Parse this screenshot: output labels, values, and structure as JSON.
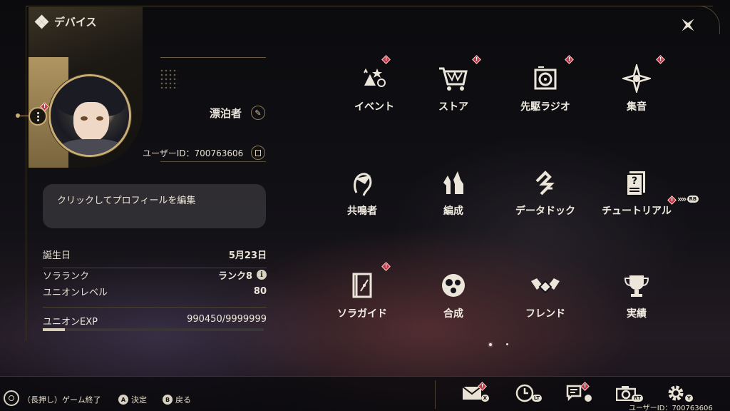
{
  "header": {
    "title": "デバイス"
  },
  "profile": {
    "nickname": "漂泊者",
    "user_id_label": "ユーザーID：700763606",
    "edit_profile_text": "クリックしてプロフィールを編集",
    "stats": [
      {
        "label": "誕生日",
        "value": "5月23日"
      },
      {
        "label": "ソラランク",
        "value": "ランク8"
      },
      {
        "label": "ユニオンレベル",
        "value": "80"
      }
    ],
    "exp": {
      "label": "ユニオンEXP",
      "value": "990450/9999999",
      "fraction": 0.099
    },
    "info_glyph": "i"
  },
  "grid": {
    "items": [
      {
        "label": "イベント",
        "icon": "event-icon",
        "badge": true
      },
      {
        "label": "ストア",
        "icon": "store-cart-icon",
        "badge": true
      },
      {
        "label": "先駆ラジオ",
        "icon": "radio-icon",
        "badge": true
      },
      {
        "label": "集音",
        "icon": "compass-star-icon",
        "badge": true
      },
      {
        "label": "共鳴者",
        "icon": "resonator-head-icon",
        "badge": false
      },
      {
        "label": "編成",
        "icon": "team-chess-icon",
        "badge": false
      },
      {
        "label": "データドック",
        "icon": "data-dock-icon",
        "badge": false
      },
      {
        "label": "チュートリアル",
        "icon": "tutorial-icon",
        "badge": false
      },
      {
        "label": "ソラガイド",
        "icon": "guide-book-icon",
        "badge": true
      },
      {
        "label": "合成",
        "icon": "synthesis-icon",
        "badge": false
      },
      {
        "label": "フレンド",
        "icon": "handshake-icon",
        "badge": false
      },
      {
        "label": "実績",
        "icon": "trophy-icon",
        "badge": false
      }
    ],
    "rb_label": "RB"
  },
  "footer": {
    "hint_exit": "（長押し）ゲーム終了",
    "hint_confirm": "決定",
    "hint_back": "戻る",
    "glyph_a": "A",
    "glyph_b": "B",
    "buttons": [
      {
        "name": "mail",
        "tag": "X"
      },
      {
        "name": "clock",
        "tag": "LT"
      },
      {
        "name": "notice",
        "tag": ""
      },
      {
        "name": "camera",
        "tag": "RT"
      },
      {
        "name": "settings",
        "tag": "Y"
      }
    ],
    "user_id": "ユーザーID：700763606"
  },
  "colors": {
    "accent_gold": "#c9ad74",
    "alert_red": "#c23a47",
    "text": "#ece6da"
  }
}
